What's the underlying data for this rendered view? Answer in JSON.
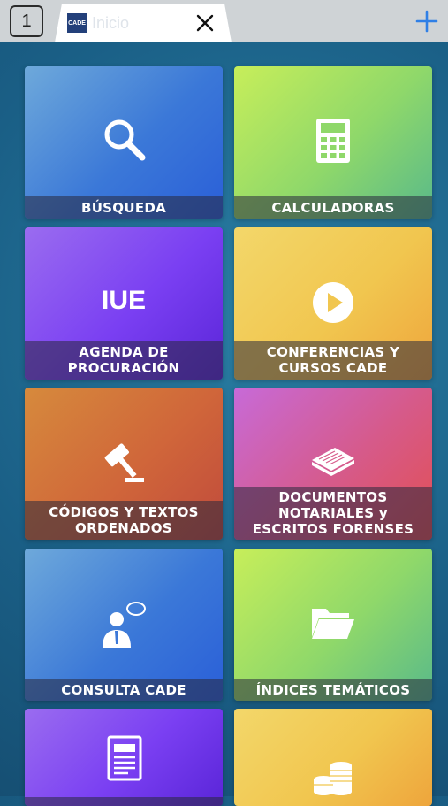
{
  "tabbar": {
    "tab_count": "1",
    "tab_title": "Inicio",
    "logo_text": "CADE",
    "close_icon": "close-icon",
    "add_icon": "plus-icon",
    "accent": "#2f7fe6"
  },
  "tiles": [
    {
      "label": "BÚSQUEDA",
      "icon": "search-icon"
    },
    {
      "label": "CALCULADORAS",
      "icon": "calculator-icon"
    },
    {
      "label": "AGENDA DE\nPROCURACIÓN",
      "icon": "iue-logo-icon",
      "icon_text": "IUE"
    },
    {
      "label": "CONFERENCIAS Y\nCURSOS CADE",
      "icon": "play-icon"
    },
    {
      "label": "CÓDIGOS Y TEXTOS\nORDENADOS",
      "icon": "gavel-icon"
    },
    {
      "label": "DOCUMENTOS\nNOTARIALES y\nESCRITOS FORENSES",
      "icon": "documents-stack-icon"
    },
    {
      "label": "CONSULTA CADE",
      "icon": "consultant-icon"
    },
    {
      "label": "ÍNDICES TEMÁTICOS",
      "icon": "folder-icon"
    },
    {
      "label": "",
      "icon": "newspaper-icon"
    },
    {
      "label": "",
      "icon": "coins-icon"
    }
  ]
}
